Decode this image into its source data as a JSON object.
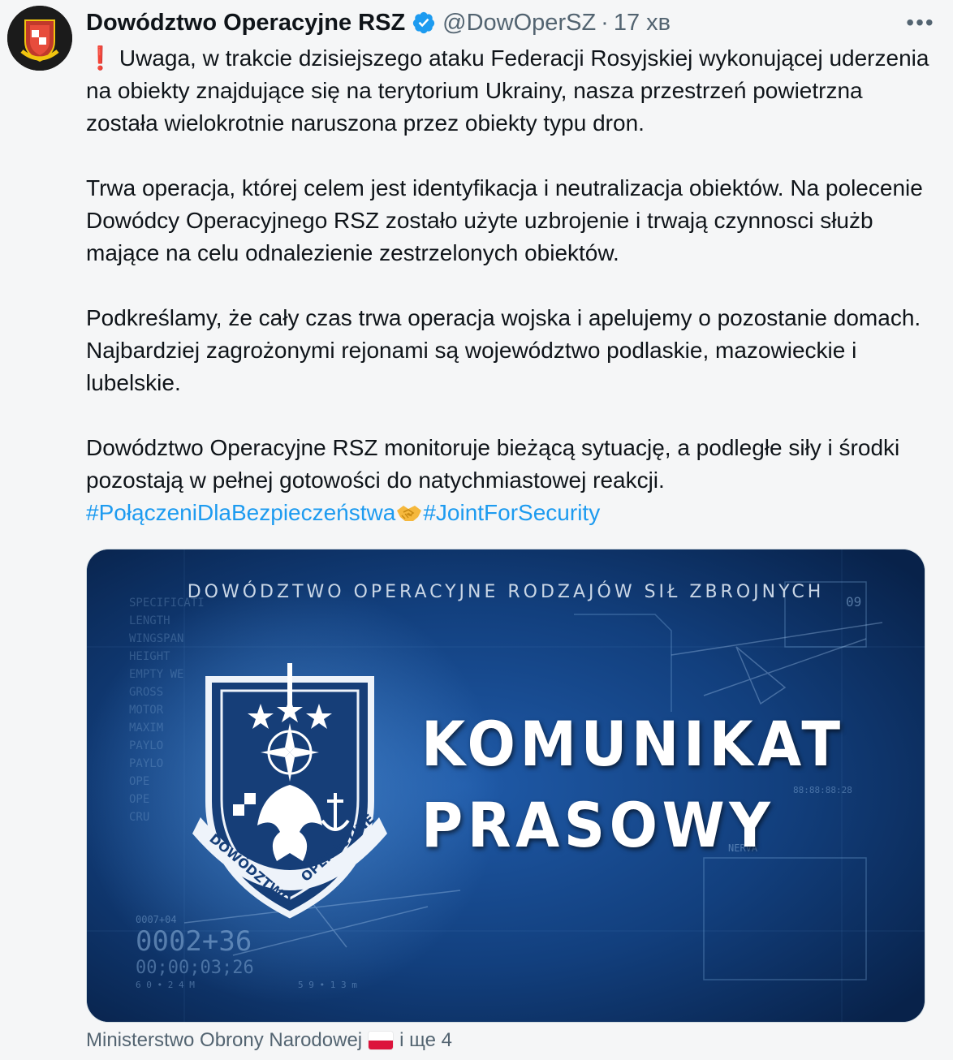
{
  "author": {
    "display_name": "Dowództwo Operacyjne RSZ",
    "handle": "@DowOperSZ",
    "separator": "·",
    "time": "17 хв",
    "verified_color": "#1d9bf0"
  },
  "menu": {
    "more_label": "•••"
  },
  "tweet": {
    "p1_icon": "❗",
    "p1": "Uwaga, w trakcie dzisiejszego ataku Federacji Rosyjskiej wykonującej uderzenia na obiekty znajdujące się na terytorium Ukrainy, nasza przestrzeń powietrzna została wielokrotnie naruszona przez obiekty typu dron.",
    "p2": "Trwa operacja, której celem jest identyfikacja i neutralizacja obiektów. Na polecenie Dowódcy Operacyjnego RSZ zostało użyte uzbrojenie i trwają czynnosci służb mające na celu odnalezienie zestrzelonych obiektów.",
    "p3": "Podkreślamy, że cały czas trwa operacja wojska i apelujemy o pozostanie domach. Najbardziej zagrożonymi rejonami są województwo podlaskie, mazowieckie i lubelskie.",
    "p4": "Dowództwo Operacyjne RSZ monitoruje bieżącą sytuację, a podległe siły i środki pozostają w pełnej gotowości do natychmiastowej reakcji.",
    "hashtag1": "#PołączeniDlaBezpieczeństwa",
    "hashtag2": "#JointForSecurity",
    "hashtag_color": "#1d9bf0"
  },
  "media": {
    "heading": "DOWÓDZTWO OPERACYJNE RODZAJÓW SIŁ ZBROJNYCH",
    "title_line1": "KOMUNIKAT",
    "title_line2": "PRASOWY",
    "badge_text_left": "DOWÓDZTWO",
    "badge_text_right": "OPERACYJNE",
    "hud_counter": "0002+36",
    "hud_time": "00;00;03;26",
    "hud_small1": "0007+04",
    "hud_small2": "09",
    "hud_small3": "88:88:88:28",
    "hud_label": "NERVA",
    "hud_left_labels": [
      "SPECIFICATI",
      "LENGTH",
      "WINGSPAN",
      "HEIGHT",
      "EMPTY WE",
      "GROSS",
      "MOTOR",
      "MAXIM",
      "PAYLO",
      "PAYLO",
      "OPE",
      "OPE",
      "CRU"
    ],
    "hud_bottom_left": "6 0 • 2 4 M",
    "hud_bottom_mid": "5 9 • 1 3 m"
  },
  "footer": {
    "text": "Ministerstwo Obrony Narodowej",
    "more": "і ще 4"
  }
}
